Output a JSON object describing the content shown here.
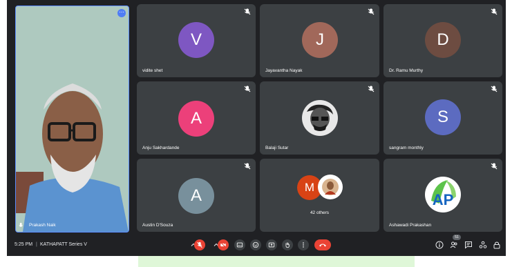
{
  "meeting": {
    "time": "5:25 PM",
    "separator": "|",
    "title": "KATHAPATT Series V"
  },
  "self_view": {
    "name": "Prakash Naik",
    "options_glyph": "⋯"
  },
  "participants": [
    {
      "name": "vidite shet",
      "initial": "V",
      "color": "#7e57c2"
    },
    {
      "name": "Jayavantha Nayak",
      "initial": "J",
      "color": "#a1685a"
    },
    {
      "name": "Dr. Ramu Murthy",
      "initial": "D",
      "color": "#6d4c41"
    },
    {
      "name": "Anju Sakhardande",
      "initial": "A",
      "color": "#ec407a"
    },
    {
      "name": "Balaji Sutar",
      "initial": "",
      "color": "#e6e6e6"
    },
    {
      "name": "sangram monthly",
      "initial": "S",
      "color": "#5c6bc0"
    },
    {
      "name": "Austin D'Souza",
      "initial": "A",
      "color": "#78909c"
    },
    {
      "name": "42 others",
      "initial": "M",
      "color": "#d84315"
    },
    {
      "name": "Ashawadi Prakashan",
      "initial": "AP",
      "color": "#ffffff"
    }
  ],
  "controls": {
    "participants_badge": "51"
  },
  "icons": {
    "mic_off": "mic-off-icon",
    "camera_off": "camera-off-icon",
    "captions": "captions-icon",
    "emoji": "emoji-icon",
    "present": "present-icon",
    "raise_hand": "raise-hand-icon",
    "more": "more-options-icon",
    "end_call": "end-call-icon",
    "info": "info-icon",
    "people": "people-icon",
    "chat": "chat-icon",
    "activities": "activities-icon",
    "host_controls": "host-controls-icon"
  }
}
